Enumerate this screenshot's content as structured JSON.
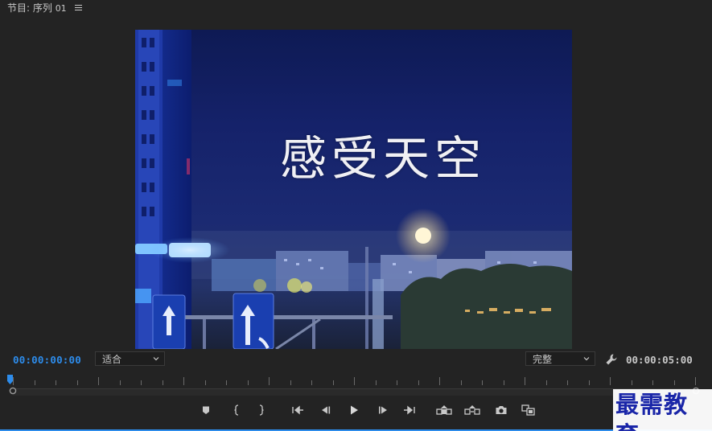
{
  "panel": {
    "title": "节目: 序列",
    "sequence_number": "01",
    "menu_icon": "hamburger-icon"
  },
  "video": {
    "caption": "感受天空"
  },
  "controls": {
    "current_timecode": "00:00:00:00",
    "fit_select": "适合",
    "quality_select": "完整",
    "duration_timecode": "00:00:05:00",
    "playhead_fraction": 0.0
  },
  "transport": [
    {
      "name": "add-marker-button",
      "icon": "marker-icon"
    },
    {
      "name": "mark-in-button",
      "icon": "mark-in-icon"
    },
    {
      "name": "mark-out-button",
      "icon": "mark-out-icon"
    },
    {
      "name": "go-to-in-button",
      "icon": "go-to-in-icon"
    },
    {
      "name": "step-back-button",
      "icon": "step-back-icon"
    },
    {
      "name": "play-button",
      "icon": "play-icon"
    },
    {
      "name": "step-forward-button",
      "icon": "step-forward-icon"
    },
    {
      "name": "go-to-out-button",
      "icon": "go-to-out-icon"
    },
    {
      "name": "lift-button",
      "icon": "lift-icon"
    },
    {
      "name": "extract-button",
      "icon": "extract-icon"
    },
    {
      "name": "export-frame-button",
      "icon": "camera-icon"
    },
    {
      "name": "compare-view-button",
      "icon": "compare-icon"
    }
  ],
  "watermark": "最需教育",
  "colors": {
    "accent": "#2d8ceb",
    "text": "#c8c8c8",
    "background": "#232323"
  }
}
